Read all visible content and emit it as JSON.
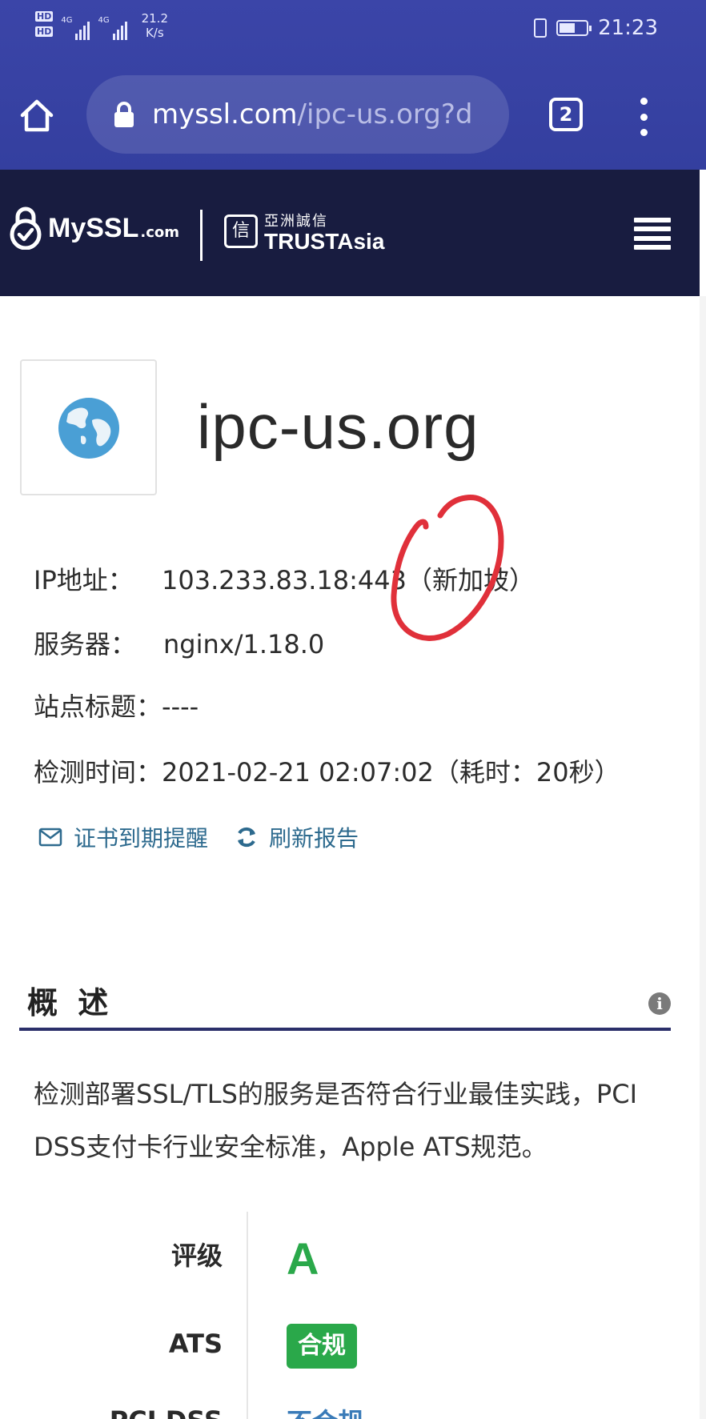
{
  "status_bar": {
    "hd1": "HD",
    "hd2": "HD",
    "sim1": "4G",
    "sim2": "4G",
    "speed_value": "21.2",
    "speed_unit": "K/s",
    "time": "21:23",
    "battery_level": 0.6,
    "icons": [
      "vibrate-icon",
      "battery-icon",
      "signal-icon"
    ]
  },
  "browser": {
    "url_domain": "myssl.com",
    "url_path": "/ipc-us.org?d",
    "tab_count": "2",
    "icons": [
      "home-icon",
      "lock-icon",
      "tabs-icon",
      "more-vert-icon"
    ]
  },
  "site_header": {
    "logo_myssl": "MySSL",
    "logo_myssl_suffix": ".com",
    "logo_trustasia_cn": "亞洲誠信",
    "logo_trustasia_en": "TRUSTAsia",
    "logo_trustasia_mark": "信",
    "icons": [
      "myssl-lock-logo",
      "menu-icon"
    ]
  },
  "site": {
    "domain": "ipc-us.org",
    "icon": "globe-icon"
  },
  "info": {
    "ip_label": "IP地址：",
    "ip_value": "103.233.83.18:443（新加坡）",
    "server_label": "服务器：",
    "server_value": "nginx/1.18.0",
    "title_label": "站点标题：",
    "title_value": "----",
    "time_label": "检测时间：",
    "time_value": "2021-02-21 02:07:02（耗时：20秒）"
  },
  "actions": {
    "expiry_reminder": "证书到期提醒",
    "refresh_report": "刷新报告",
    "icons": [
      "mail-icon",
      "refresh-icon"
    ]
  },
  "overview": {
    "title": "概 述",
    "description": "检测部署SSL/TLS的服务是否符合行业最佳实践，PCI DSS支付卡行业安全标准，Apple ATS规范。",
    "icon": "info-icon"
  },
  "grades": {
    "rating_label": "评级",
    "rating_value": "A",
    "ats_label": "ATS",
    "ats_value": "合规",
    "pci_label": "PCI DSS",
    "pci_value": "不合规"
  },
  "colors": {
    "chrome": "#3b45a8",
    "site_header": "#181c40",
    "grade_green": "#2aa84a",
    "link_blue": "#2d6a8e",
    "annotation_red": "#e0303a"
  }
}
